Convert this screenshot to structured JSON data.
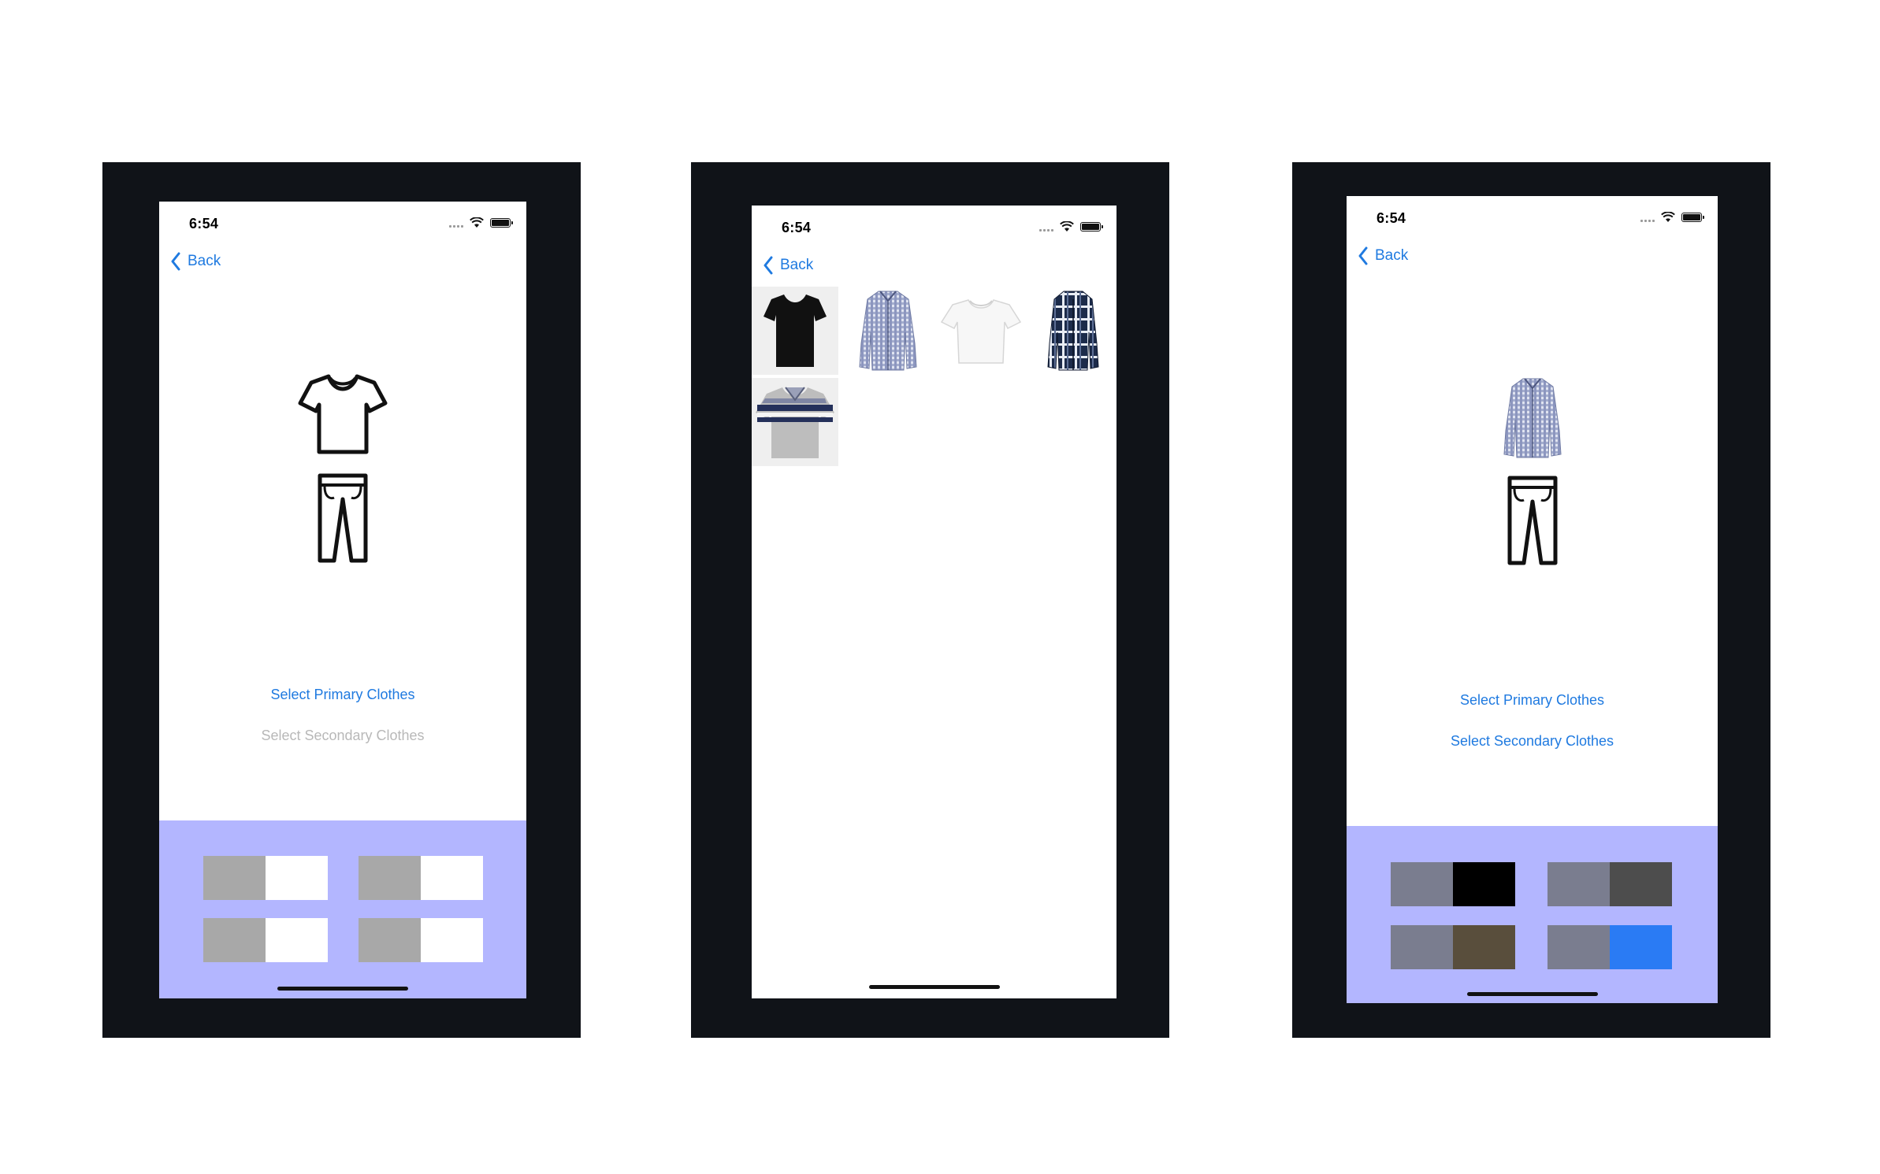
{
  "screens": {
    "screen1": {
      "time": "6:54",
      "back_label": "Back",
      "primary_link": "Select Primary Clothes",
      "secondary_link": "Select Secondary Clothes",
      "secondary_enabled": false,
      "top_icon": "tshirt-outline-icon",
      "bottom_icon": "pants-outline-icon",
      "palettes": [
        [
          "#a8a8a8",
          "#ffffff"
        ],
        [
          "#a8a8a8",
          "#ffffff"
        ],
        [
          "#a8a8a8",
          "#ffffff"
        ],
        [
          "#a8a8a8",
          "#ffffff"
        ]
      ]
    },
    "screen2": {
      "time": "6:54",
      "back_label": "Back",
      "items": [
        {
          "name": "black-tshirt-image",
          "color": "#111111"
        },
        {
          "name": "gingham-shirt-image",
          "color": "#6f7aa3"
        },
        {
          "name": "white-tshirt-image",
          "color": "#f4f4f4"
        },
        {
          "name": "plaid-flannel-image",
          "color": "#1c2b4a"
        },
        {
          "name": "striped-polo-image",
          "color": "#b9b9b9"
        }
      ]
    },
    "screen3": {
      "time": "6:54",
      "back_label": "Back",
      "primary_link": "Select Primary Clothes",
      "secondary_link": "Select Secondary Clothes",
      "secondary_enabled": true,
      "top_icon": "gingham-shirt-image",
      "bottom_icon": "pants-outline-icon",
      "palettes": [
        [
          "#7a7d8f",
          "#000000"
        ],
        [
          "#7a7d8f",
          "#4d4d4d"
        ],
        [
          "#7a7d8f",
          "#594e3c"
        ],
        [
          "#7a7d8f",
          "#2a7bf4"
        ]
      ]
    }
  },
  "colors": {
    "frame": "#101318",
    "accent": "#1f7ae0",
    "disabled": "#b8b8b8",
    "palette_panel": "#b3b6ff"
  }
}
